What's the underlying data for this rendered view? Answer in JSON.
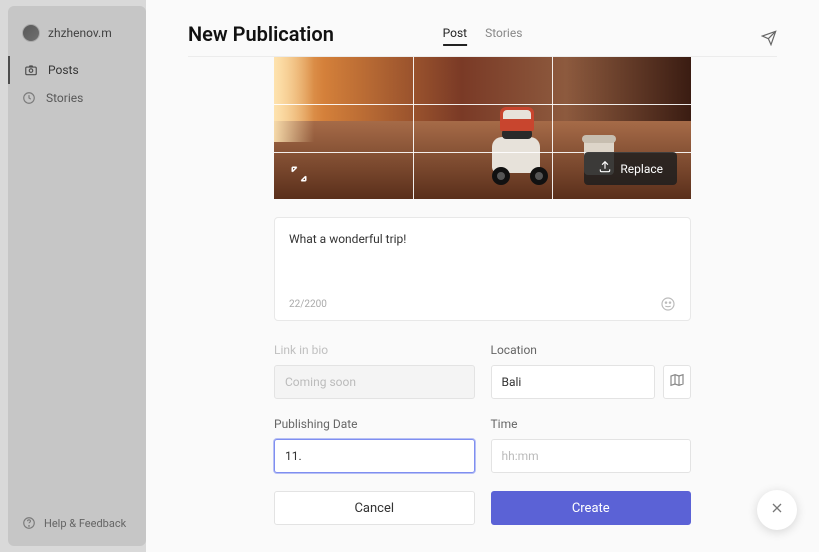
{
  "user": {
    "name": "zhzhenov.m"
  },
  "sidebar": {
    "items": [
      {
        "label": "Posts",
        "icon": "camera-icon"
      },
      {
        "label": "Stories",
        "icon": "clock-icon"
      }
    ],
    "help_label": "Help & Feedback"
  },
  "header": {
    "title": "New Publication",
    "tabs": [
      {
        "label": "Post",
        "active": true
      },
      {
        "label": "Stories",
        "active": false
      }
    ]
  },
  "image": {
    "replace_label": "Replace"
  },
  "caption": {
    "text": "What a wonderful trip!",
    "counter": "22/2200"
  },
  "link_in_bio": {
    "label": "Link in bio",
    "placeholder": "Coming soon"
  },
  "location": {
    "label": "Location",
    "value": "Bali"
  },
  "date": {
    "label": "Publishing Date",
    "value": "11."
  },
  "time": {
    "label": "Time",
    "placeholder": "hh:mm",
    "value": ""
  },
  "buttons": {
    "cancel": "Cancel",
    "create": "Create"
  }
}
